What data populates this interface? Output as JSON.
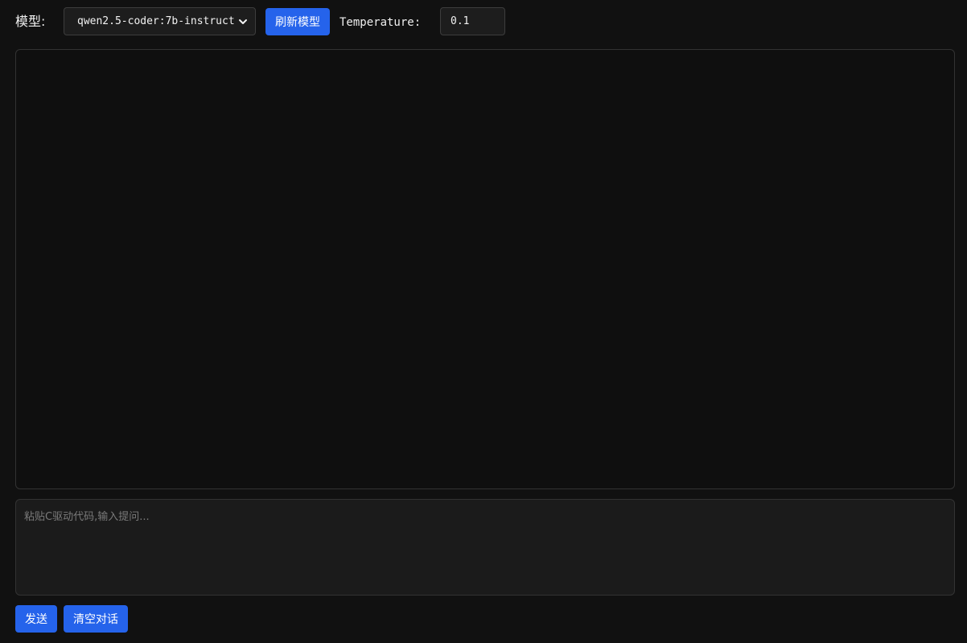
{
  "header": {
    "model_label": "模型:",
    "model_selected": "qwen2.5-coder:7b-instruct",
    "refresh_button": "刷新模型",
    "temperature_label": "Temperature:",
    "temperature_value": "0.1"
  },
  "chat": {
    "messages": []
  },
  "prompt": {
    "placeholder": "粘贴C驱动代码,输入提问..."
  },
  "actions": {
    "send_button": "发送",
    "clear_button": "清空对话"
  },
  "colors": {
    "background": "#111111",
    "accent": "#2563eb",
    "panel_border": "#333333"
  },
  "icons": {
    "select_chevron": "chevron-down-icon"
  }
}
